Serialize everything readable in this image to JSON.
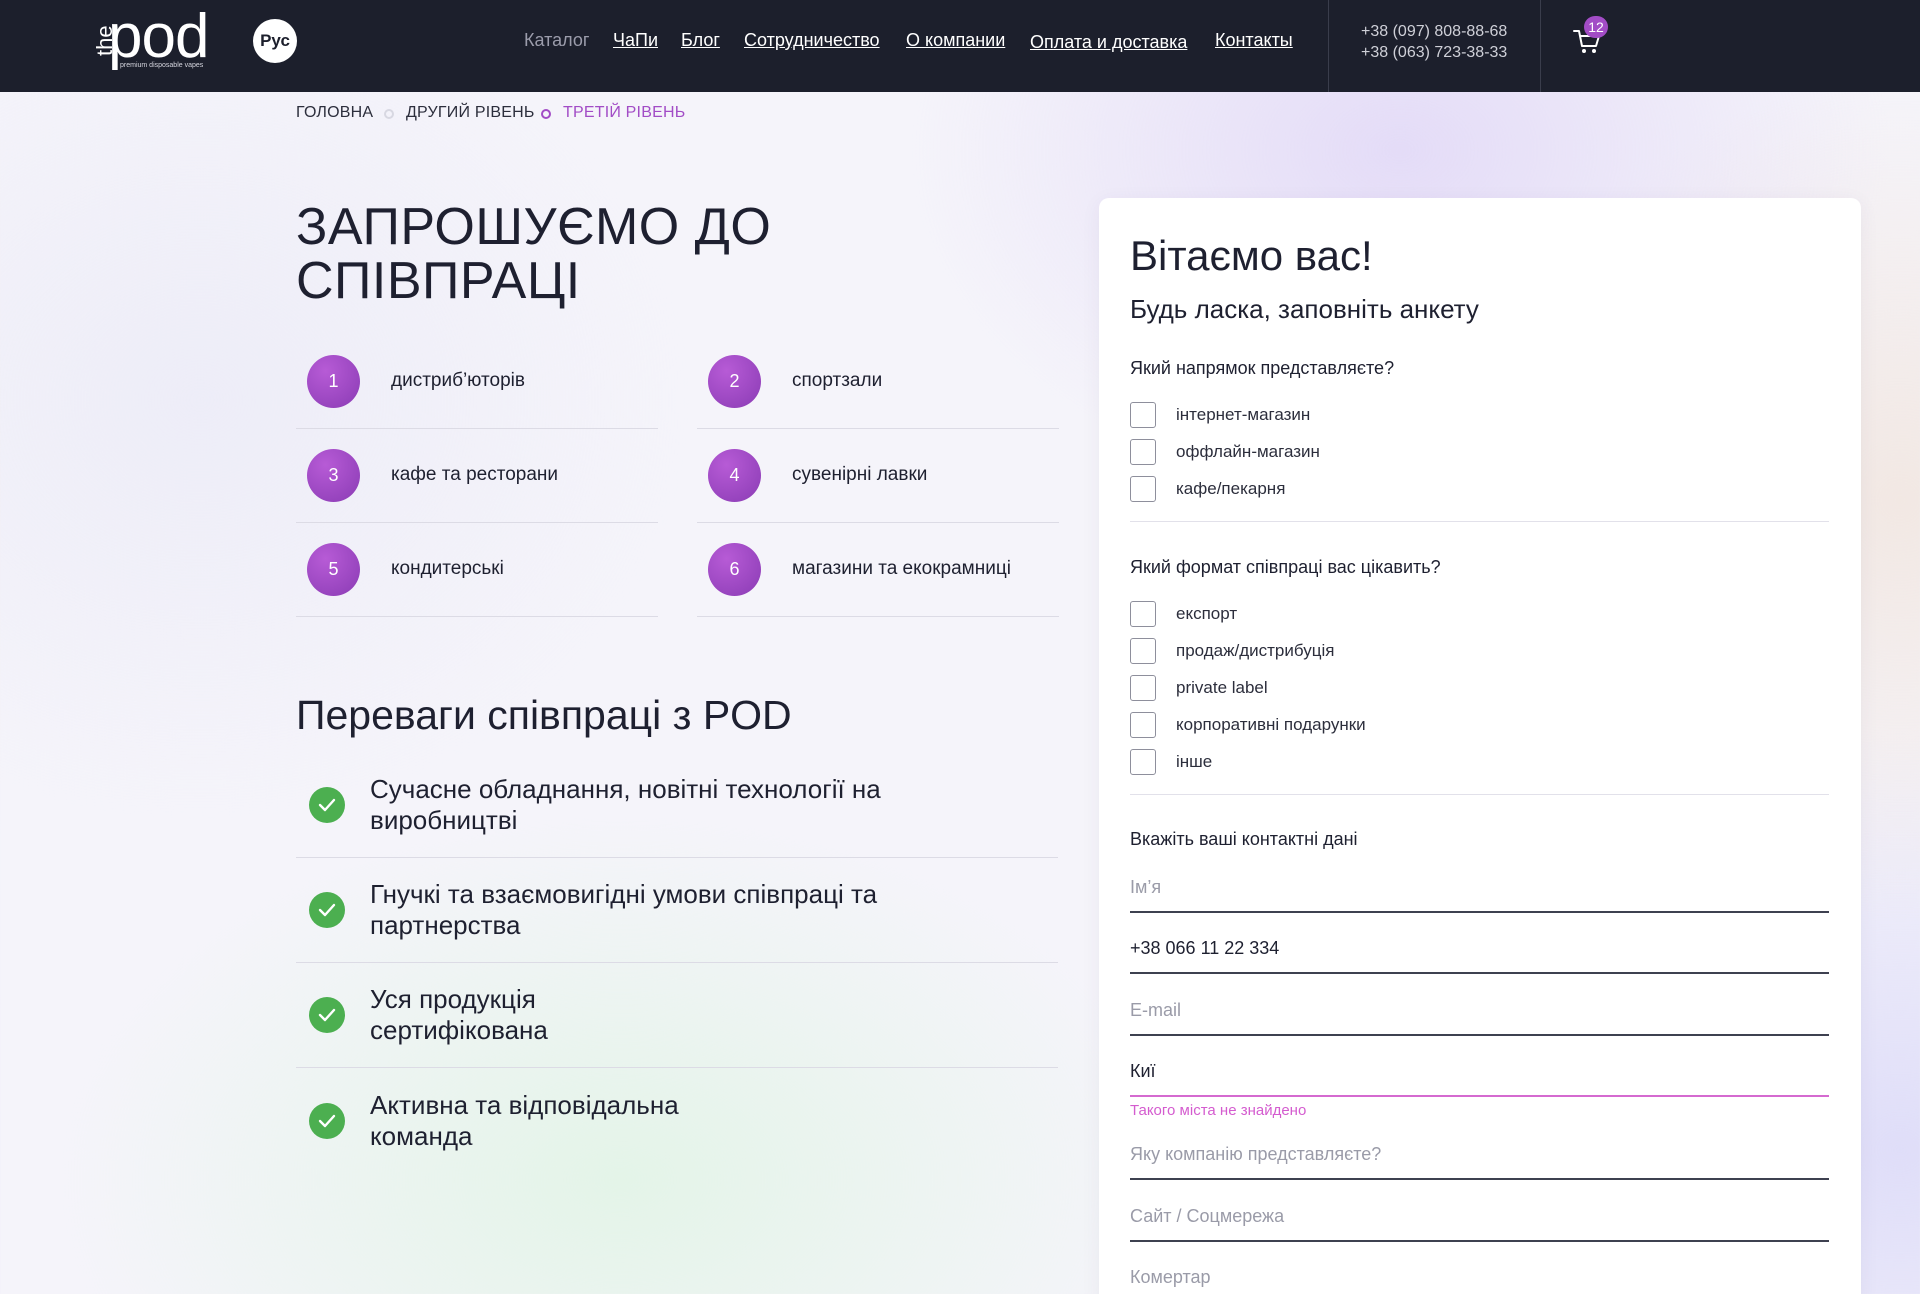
{
  "header": {
    "logo": {
      "the": "the",
      "pod": "pod",
      "tagline": "premium disposable vapes"
    },
    "lang_label": "Рус",
    "nav": [
      {
        "label": "Каталог"
      },
      {
        "label": "ЧаПи"
      },
      {
        "label": "Блог"
      },
      {
        "label": "Сотрудничество"
      },
      {
        "label": "О компании"
      },
      {
        "label": "Оплата и доставка"
      },
      {
        "label": "Контакты"
      }
    ],
    "phones": [
      "+38 (097) 808-88-68",
      "+38 (063) 723-38-33"
    ],
    "cart_count": "12"
  },
  "breadcrumb": [
    {
      "label": "ГОЛОВНА"
    },
    {
      "label": "ДРУГИЙ РІВЕНЬ"
    },
    {
      "label": "ТРЕТІЙ РІВЕНЬ"
    }
  ],
  "main": {
    "title": "ЗАПРОШУЄМО ДО СПІВПРАЦІ",
    "audience": [
      {
        "num": "1",
        "label": "дистриб’юторів"
      },
      {
        "num": "2",
        "label": "спортзали"
      },
      {
        "num": "3",
        "label": "кафе та ресторани"
      },
      {
        "num": "4",
        "label": "сувенірні лавки"
      },
      {
        "num": "5",
        "label": "кондитерські"
      },
      {
        "num": "6",
        "label": "магазини та екокрамниці"
      }
    ],
    "advantages_title": "Переваги співпраці з POD",
    "advantages": [
      {
        "text": "Сучасне обладнання, новітні технології на виробництві"
      },
      {
        "text": "Гнучкі та взаємовигідні умови співпраці та партнерства"
      },
      {
        "text": "Уся продукція сертифікована"
      },
      {
        "text": "Активна та відповідальна команда"
      }
    ]
  },
  "form": {
    "title": "Вітаємо вас!",
    "subtitle": "Будь ласка, заповніть анкету",
    "q1": {
      "label": "Який напрямок представляєте?",
      "options": [
        "інтернет-магазин",
        "оффлайн-магазин",
        "кафе/пекарня"
      ]
    },
    "q2": {
      "label": "Який формат співпраці вас цікавить?",
      "options": [
        "експорт",
        "продаж/дистрибуція",
        "private label",
        "корпоративні подарунки",
        "інше"
      ]
    },
    "contacts": {
      "label": "Вкажіть ваші контактні дані",
      "name_placeholder": "Ім’я",
      "phone_value": "+38 066 11 22 334",
      "email_placeholder": "E-mail",
      "city_value": "Киї",
      "city_error": "Такого міста не знайдено",
      "company_placeholder": "Яку компанію представляєте?",
      "site_placeholder": "Сайт / Соцмережа",
      "comment_placeholder": "Комертар"
    }
  }
}
